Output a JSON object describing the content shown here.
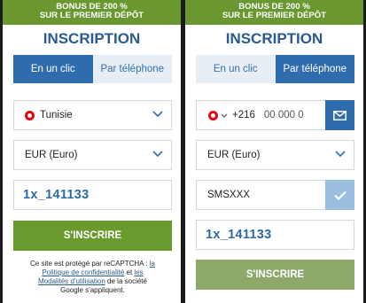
{
  "left": {
    "banner": {
      "line1": "BONUS DE 200 %",
      "line2": "SUR LE PREMIER DÉPÔT"
    },
    "title": "INSCRIPTION",
    "tabs": [
      {
        "label": "En un clic",
        "active": true
      },
      {
        "label": "Par téléphone",
        "active": false
      }
    ],
    "country_select": {
      "value": "Tunisie",
      "flag": "tunisia-flag-icon"
    },
    "currency_select": {
      "value": "EUR (Euro)"
    },
    "promo_code": {
      "value": "1x_141133"
    },
    "submit_label": "S'INSCRIRE",
    "captcha": {
      "prefix": "Ce site est protégé par reCAPTCHA : ",
      "link1_a": "la",
      "link1_b": "Politique de confidentialité",
      "mid": " et ",
      "link2_a": "les",
      "link2_b": "Modalités d'utilisation",
      "suffix_a": " de la société",
      "suffix_b": "Google s'appliquent."
    }
  },
  "right": {
    "banner": {
      "line1": "BONUS DE 200 %",
      "line2": "SUR LE PREMIER DÉPÔT"
    },
    "title": "INSCRIPTION",
    "tabs": [
      {
        "label": "En un clic",
        "active": false
      },
      {
        "label": "Par téléphone",
        "active": true
      }
    ],
    "phone": {
      "dial_code": "+216",
      "placeholder": "00 000 0",
      "flag": "tunisia-flag-icon"
    },
    "currency_select": {
      "value": "EUR (Euro)"
    },
    "sms_code": {
      "value": "SMSXXX"
    },
    "promo_code": {
      "value": "1x_141133"
    },
    "submit_label": "S'INSCRIRE"
  },
  "colors": {
    "banner_green": "#6a9730",
    "title_blue": "#2c5a8f",
    "tab_active": "#2f6cae",
    "tab_inactive_bg": "#e7eef6",
    "submit_green": "#6a9a2e",
    "submit_green_disabled": "#8ea86a",
    "confirm_light_blue": "#9bbde0"
  }
}
